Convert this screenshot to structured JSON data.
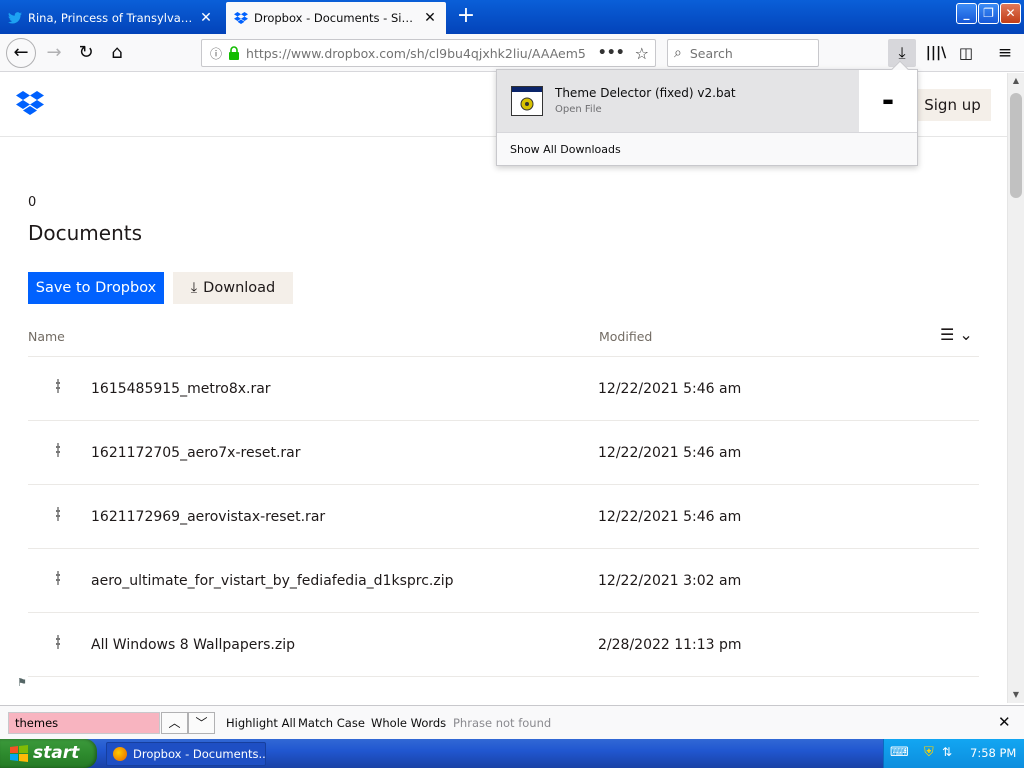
{
  "browser": {
    "tabs": [
      {
        "label": "Rina, Princess of Transylvania (@",
        "active": false,
        "icon": "twitter-bird-icon"
      },
      {
        "label": "Dropbox - Documents - Simplify yo",
        "active": true,
        "icon": "dropbox-icon"
      }
    ],
    "url": "https://www.dropbox.com/sh/cl9bu4qjxhk2liu/AAAem5",
    "search_placeholder": "Search",
    "new_tab_symbol": "+"
  },
  "downloads_panel": {
    "filename": "Theme Delector (fixed) v2.bat",
    "status": "Open File",
    "show_all": "Show All Downloads"
  },
  "page": {
    "signup": "Sign up",
    "count": "0",
    "title": "Documents",
    "save_button": "Save to Dropbox",
    "download_button": "Download",
    "col_name": "Name",
    "col_modified": "Modified",
    "files": [
      {
        "name": "1615485915_metro8x.rar",
        "modified": "12/22/2021 5:46 am"
      },
      {
        "name": "1621172705_aero7x-reset.rar",
        "modified": "12/22/2021 5:46 am"
      },
      {
        "name": "1621172969_aerovistax-reset.rar",
        "modified": "12/22/2021 5:46 am"
      },
      {
        "name": "aero_ultimate_for_vistart_by_fediafedia_d1ksprc.zip",
        "modified": "12/22/2021 3:02 am"
      },
      {
        "name": "All Windows 8 Wallpapers.zip",
        "modified": "2/28/2022 11:13 pm"
      }
    ]
  },
  "findbar": {
    "query": "themes",
    "highlight_all": "Highlight All",
    "match_case": "Match Case",
    "whole_words": "Whole Words",
    "status": "Phrase not found"
  },
  "taskbar": {
    "start": "start",
    "item": "Dropbox - Documents...",
    "clock": "7:58 PM"
  },
  "colors": {
    "accent": "#0061fe",
    "titlebar": "#0a5fd8",
    "findbar_notfound": "#f8b4c0",
    "start_green": "#2e8b2e"
  }
}
